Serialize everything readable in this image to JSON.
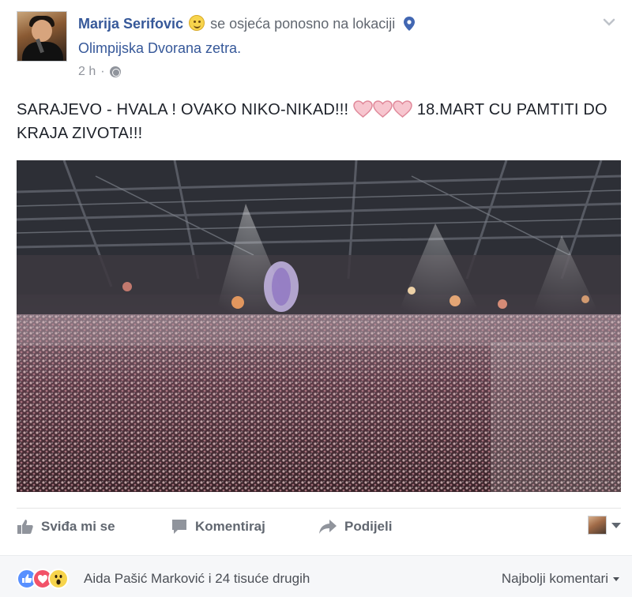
{
  "post": {
    "author": "Marija Serifovic",
    "feeling_icon": "slightly-smiling-face-icon",
    "activity": "se osjeća ponosno na lokaciji",
    "location": "Olimpijska Dvorana zetra.",
    "time": "2 h",
    "privacy_icon": "globe-icon",
    "text_part1": "SARAJEVO - HVALA ! OVAKO NIKO-NIKAD!!!",
    "text_part2": "18.MART CU PAMTITI DO KRAJA ZIVOTA!!!",
    "hearts": [
      "heart-icon",
      "heart-icon",
      "heart-icon"
    ],
    "photo": "concert-crowd-arena-photo"
  },
  "actions": {
    "like": "Sviđa mi se",
    "comment": "Komentiraj",
    "share": "Podijeli"
  },
  "reactions": {
    "icons": [
      "like-reaction-icon",
      "love-reaction-icon",
      "wow-reaction-icon"
    ],
    "summary": "Aida Pašić Marković i 24 tisuće drugih",
    "sort_label": "Najbolji komentari"
  },
  "colors": {
    "link": "#365899",
    "meta": "#90949c",
    "heart": "#f2a2b0",
    "like_blue": "#5890ff",
    "love_red": "#f25268"
  }
}
